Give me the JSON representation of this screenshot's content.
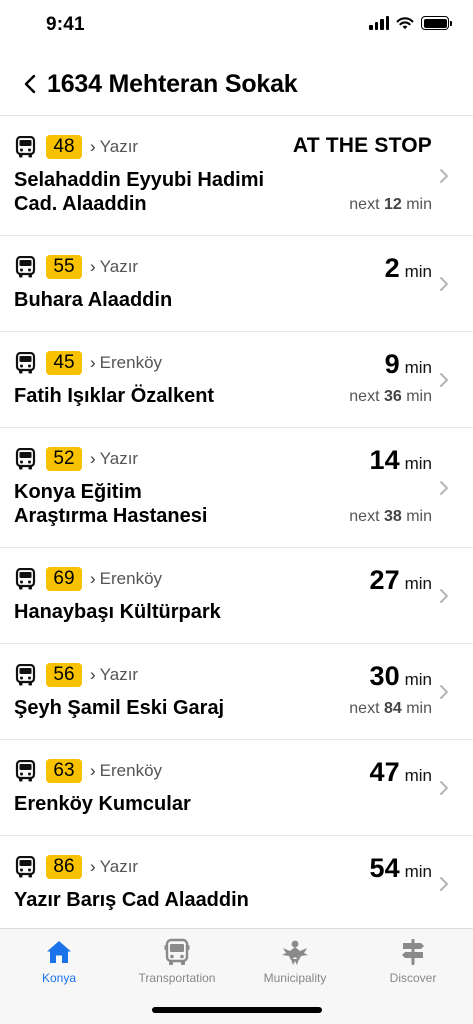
{
  "status_bar": {
    "time": "9:41"
  },
  "header": {
    "title": "1634 Mehteran Sokak"
  },
  "arrivals": [
    {
      "line": "48",
      "direction": "Yazır",
      "stop": [
        "Selahaddin Eyyubi Hadimi",
        "Cad. Alaaddin"
      ],
      "status": "AT THE STOP",
      "time": null,
      "unit": null,
      "next_prefix": "next",
      "next_value": "12",
      "next_unit": "min"
    },
    {
      "line": "55",
      "direction": "Yazır",
      "stop": [
        "Buhara Alaaddin"
      ],
      "status": null,
      "time": "2",
      "unit": "min",
      "next_prefix": null,
      "next_value": null,
      "next_unit": null
    },
    {
      "line": "45",
      "direction": "Erenköy",
      "stop": [
        "Fatih Işıklar Özalkent"
      ],
      "status": null,
      "time": "9",
      "unit": "min",
      "next_prefix": "next",
      "next_value": "36",
      "next_unit": "min"
    },
    {
      "line": "52",
      "direction": "Yazır",
      "stop": [
        "Konya Eğitim",
        "Araştırma Hastanesi"
      ],
      "status": null,
      "time": "14",
      "unit": "min",
      "next_prefix": "next",
      "next_value": "38",
      "next_unit": "min"
    },
    {
      "line": "69",
      "direction": "Erenköy",
      "stop": [
        "Hanaybaşı Kültürpark"
      ],
      "status": null,
      "time": "27",
      "unit": "min",
      "next_prefix": null,
      "next_value": null,
      "next_unit": null
    },
    {
      "line": "56",
      "direction": "Yazır",
      "stop": [
        "Şeyh Şamil Eski Garaj"
      ],
      "status": null,
      "time": "30",
      "unit": "min",
      "next_prefix": "next",
      "next_value": "84",
      "next_unit": "min"
    },
    {
      "line": "63",
      "direction": "Erenköy",
      "stop": [
        "Erenköy Kumcular"
      ],
      "status": null,
      "time": "47",
      "unit": "min",
      "next_prefix": null,
      "next_value": null,
      "next_unit": null
    },
    {
      "line": "86",
      "direction": "Yazır",
      "stop": [
        "Yazır Barış Cad Alaaddin"
      ],
      "status": null,
      "time": "54",
      "unit": "min",
      "next_prefix": null,
      "next_value": null,
      "next_unit": null
    }
  ],
  "tabs": [
    {
      "label": "Konya",
      "icon": "home-icon",
      "active": true
    },
    {
      "label": "Transportation",
      "icon": "bus-icon",
      "active": false
    },
    {
      "label": "Municipality",
      "icon": "municipality-emblem-icon",
      "active": false
    },
    {
      "label": "Discover",
      "icon": "signpost-icon",
      "active": false
    }
  ],
  "colors": {
    "badge": "#f8c200",
    "accent": "#1a73e8",
    "tab_inactive": "#888888"
  }
}
